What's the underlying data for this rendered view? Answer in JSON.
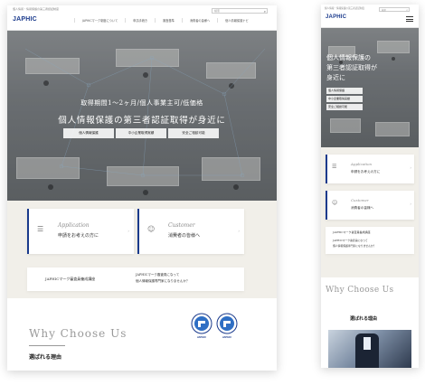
{
  "brand": {
    "logo": "JAPHIC",
    "tagline": "個人情報・情報保護の第三者認証制度",
    "accent": "#1a3a8c"
  },
  "search": {
    "placeholder": "検索",
    "icon": "search-icon"
  },
  "nav": {
    "items": [
      "JAPHICマーク制度について",
      "申請手続き",
      "審査基準",
      "消費者の皆様へ",
      "個人情報保護ナビ"
    ]
  },
  "hero": {
    "subtitle": "取得期間1〜2ヶ月/個人事業主可/低価格",
    "title": "個人情報保護の第三者認証取得が身近に",
    "pills": [
      "個人情報保護",
      "中小企業取得実績",
      "安全ご相談可能"
    ]
  },
  "cards": [
    {
      "en": "Application",
      "jp": "申請をお考えの方に",
      "icon": "document-icon"
    },
    {
      "en": "Customer",
      "jp": "消費者の皆様へ",
      "icon": "person-icon"
    }
  ],
  "mark_link": {
    "label": "JAPHICマーク審査員養成講座"
  },
  "mark_info": {
    "line1": "JAPHICマーク審査員になって",
    "line2": "個人情報保護専門家になりませんか？"
  },
  "why": {
    "title": "Why Choose Us",
    "subtitle": "選ばれる理由"
  },
  "badges": [
    {
      "label": "JAPHIC",
      "icon": "japhic-seal-icon"
    },
    {
      "label": "JAPHIC",
      "icon": "japhic-seal-icon"
    }
  ],
  "mobile": {
    "title_line1": "個人情報保護の",
    "title_line2": "第三者認証取得が",
    "title_line3": "身近に",
    "pills": [
      "個人情報保護",
      "中小企業取得実績",
      "安全ご相談可能"
    ],
    "menu_icon": "hamburger-menu-icon"
  }
}
